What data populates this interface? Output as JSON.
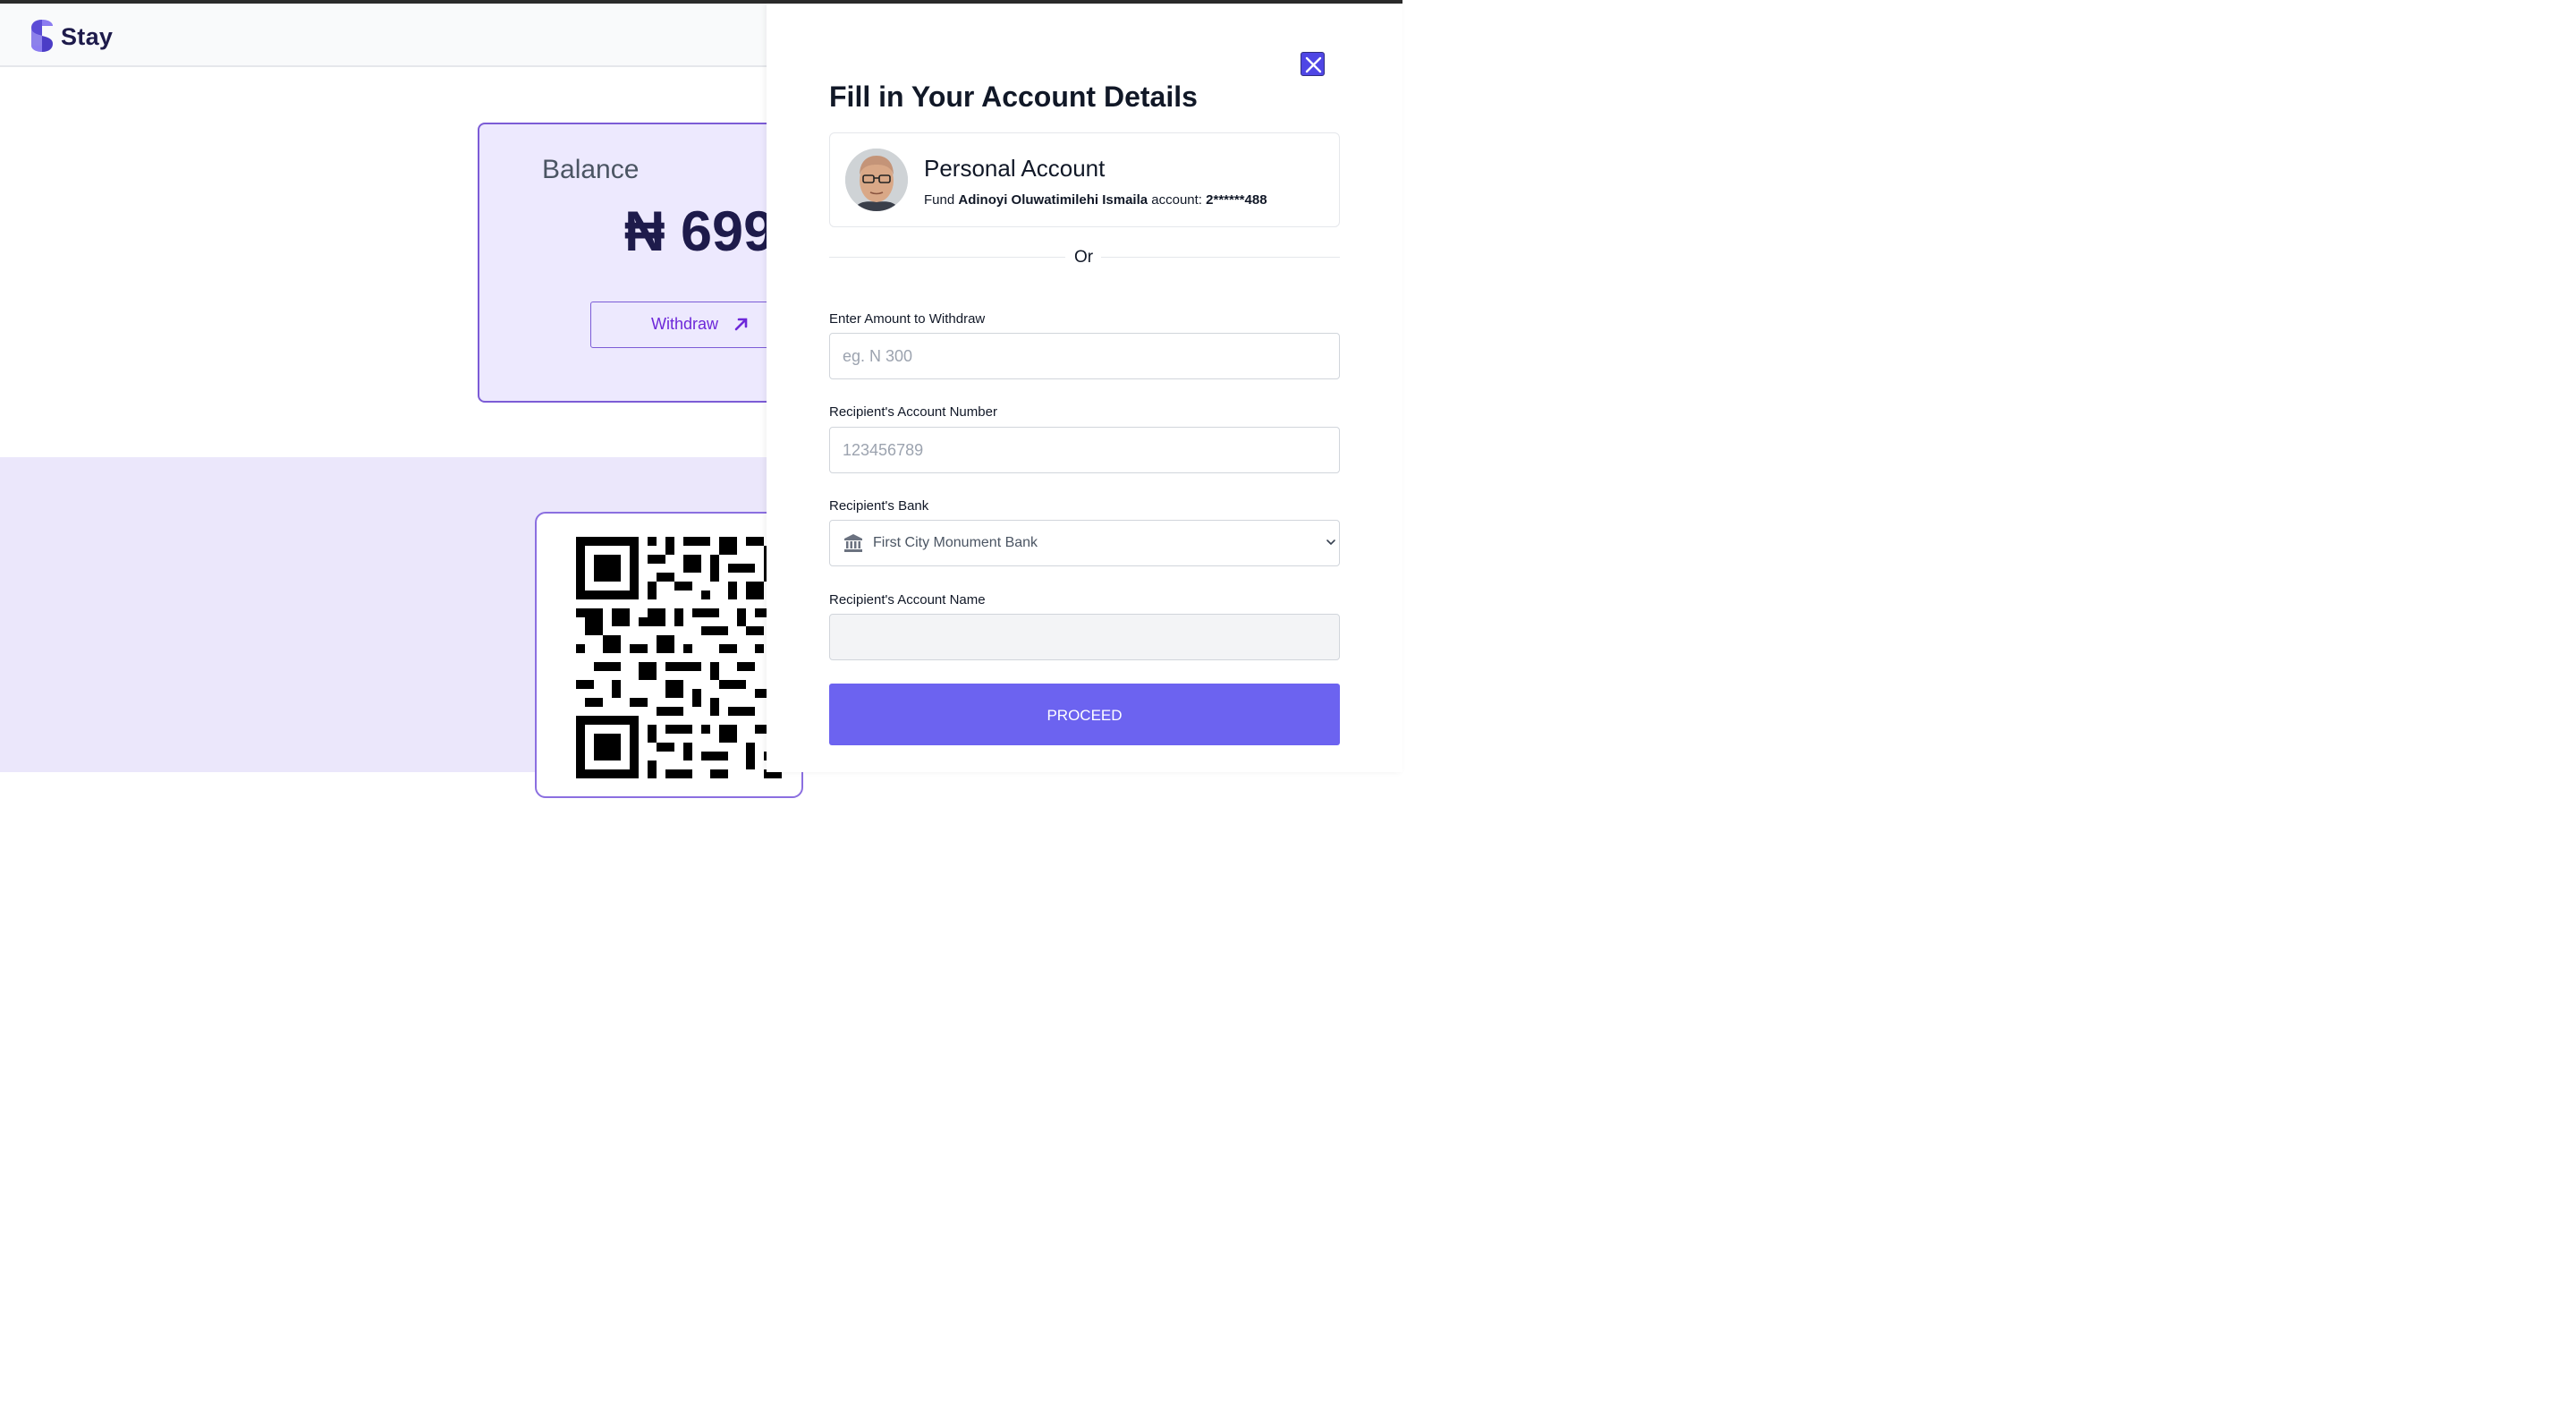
{
  "app": {
    "brand": "Stay"
  },
  "balance": {
    "label": "Balance",
    "amount": "₦ 699",
    "withdraw_label": "Withdraw"
  },
  "panel": {
    "title": "Fill in Your Account Details",
    "account": {
      "title": "Personal Account",
      "prefix": "Fund",
      "name": "Adinoyi Oluwatimilehi Ismaila",
      "middle": "account:",
      "number": "2******488"
    },
    "or_text": "Or",
    "amount_field": {
      "label": "Enter Amount to Withdraw",
      "placeholder": "eg. N 300",
      "value": ""
    },
    "account_number_field": {
      "label": "Recipient's Account Number",
      "placeholder": "123456789",
      "value": ""
    },
    "bank_field": {
      "label": "Recipient's Bank",
      "selected": "First City Monument Bank"
    },
    "account_name_field": {
      "label": "Recipient's Account Name",
      "value": ""
    },
    "proceed_label": "PROCEED"
  },
  "colors": {
    "accent": "#6c63f0",
    "close": "#4f46e5",
    "brand_dark": "#1e1b4b",
    "card_bg": "#ede9fe"
  }
}
